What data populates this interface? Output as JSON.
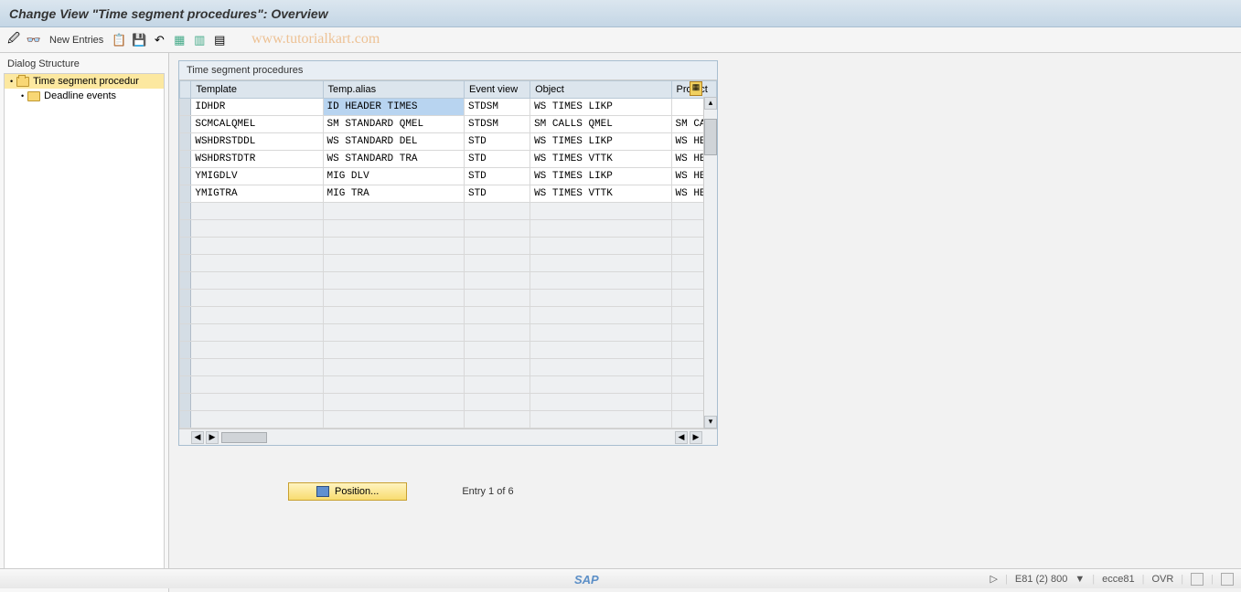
{
  "titlebar": {
    "title": "Change View \"Time segment procedures\": Overview"
  },
  "toolbar": {
    "new_entries": "New Entries"
  },
  "watermark": "www.tutorialkart.com",
  "sidebar": {
    "header": "Dialog Structure",
    "items": [
      {
        "label": "Time segment procedur",
        "selected": true
      },
      {
        "label": "Deadline events",
        "selected": false
      }
    ]
  },
  "table": {
    "title": "Time segment procedures",
    "columns": [
      "Template",
      "Temp.alias",
      "Event view",
      "Object",
      "Project"
    ],
    "rows": [
      {
        "template": "IDHDR",
        "alias": "ID HEADER TIMES",
        "event": "STDSM",
        "object": "WS TIMES LIKP",
        "project": ""
      },
      {
        "template": "SCMCALQMEL",
        "alias": "SM STANDARD    QMEL",
        "event": "STDSM",
        "object": "SM CALLS QMEL",
        "project": "SM CAL"
      },
      {
        "template": "WSHDRSTDDL",
        "alias": "WS STANDARD DEL",
        "event": "STD",
        "object": "WS TIMES LIKP",
        "project": "WS HEA"
      },
      {
        "template": "WSHDRSTDTR",
        "alias": "WS STANDARD TRA",
        "event": "STD",
        "object": "WS TIMES VTTK",
        "project": "WS HEA"
      },
      {
        "template": "YMIGDLV",
        "alias": "MIG DLV",
        "event": "STD",
        "object": "WS TIMES LIKP",
        "project": "WS HEA"
      },
      {
        "template": "YMIGTRA",
        "alias": "MIG TRA",
        "event": "STD",
        "object": "WS TIMES VTTK",
        "project": "WS HEA"
      }
    ],
    "empty_rows": 13
  },
  "footer": {
    "position_btn": "Position...",
    "entry_text": "Entry 1 of 6"
  },
  "status": {
    "system": "E81 (2) 800",
    "host": "ecce81",
    "mode": "OVR"
  },
  "sap_logo": "SAP"
}
